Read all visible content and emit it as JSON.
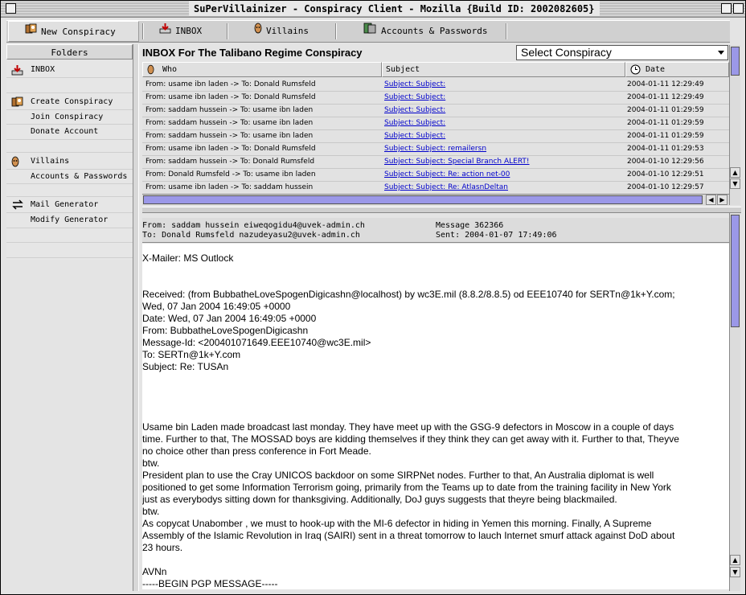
{
  "window": {
    "title": "SuPerVillainizer - Conspiracy Client - Mozilla {Build ID: 2002082605}"
  },
  "toolbar": {
    "new_conspiracy": "New Conspiracy",
    "inbox": "INBOX",
    "villains": "Villains",
    "accounts": "Accounts & Passwords"
  },
  "sidebar": {
    "header": "Folders",
    "items": {
      "inbox": "INBOX",
      "create": "Create Conspiracy",
      "join": "Join Conspiracy",
      "donate": "Donate Account",
      "villains": "Villains",
      "accounts": "Accounts & Passwords",
      "mailgen": "Mail Generator",
      "modgen": "Modify Generator"
    }
  },
  "inbox": {
    "title": "INBOX For The Talibano Regime Conspiracy",
    "select_value": "Select Conspiracy",
    "columns": {
      "who": "Who",
      "subject": "Subject",
      "date": "Date"
    },
    "rows": [
      {
        "who": "From: usame ibn laden -> To: Donald Rumsfeld",
        "subject": "Subject: Subject:",
        "date": "2004-01-11 12:29:49"
      },
      {
        "who": "From: usame ibn laden -> To: Donald Rumsfeld",
        "subject": "Subject: Subject:",
        "date": "2004-01-11 12:29:49"
      },
      {
        "who": "From: saddam hussein -> To: usame ibn laden",
        "subject": "Subject: Subject:",
        "date": "2004-01-11 01:29:59"
      },
      {
        "who": "From: saddam hussein -> To: usame ibn laden",
        "subject": "Subject: Subject:",
        "date": "2004-01-11 01:29:59"
      },
      {
        "who": "From: saddam hussein -> To: usame ibn laden",
        "subject": "Subject: Subject:",
        "date": "2004-01-11 01:29:59"
      },
      {
        "who": "From: usame ibn laden -> To: Donald Rumsfeld",
        "subject": "Subject: Subject: remailersn",
        "date": "2004-01-11 01:29:53"
      },
      {
        "who": "From: saddam hussein -> To: Donald Rumsfeld",
        "subject": "Subject: Subject: Special Branch ALERT!",
        "date": "2004-01-10 12:29:56"
      },
      {
        "who": "From: Donald Rumsfeld -> To: usame ibn laden",
        "subject": "Subject: Subject: Re: action net-00",
        "date": "2004-01-10 12:29:51"
      },
      {
        "who": "From: usame ibn laden -> To: saddam hussein",
        "subject": "Subject: Subject: Re: AtlasnDeltan",
        "date": "2004-01-10 12:29:57"
      }
    ]
  },
  "message": {
    "from": "From: saddam hussein eiweqogidu4@uvek-admin.ch",
    "to": "To: Donald Rumsfeld nazudeyasu2@uvek-admin.ch",
    "number": "Message 362366",
    "sent": "Sent: 2004-01-07 17:49:06",
    "body_lines": [
      "X-Mailer: MS Outlock",
      "",
      "",
      "Received: (from BubbatheLoveSpogenDigicashn@localhost) by wc3E.mil (8.8.2/8.8.5) od EEE10740 for SERTn@1k+Y.com;",
      "Wed, 07 Jan 2004 16:49:05 +0000",
      "Date: Wed, 07 Jan 2004 16:49:05 +0000",
      "From: BubbatheLoveSpogenDigicashn",
      "Message-Id: <200401071649.EEE10740@wc3E.mil>",
      "To: SERTn@1k+Y.com",
      "Subject: Re: TUSAn",
      "",
      "",
      "",
      "",
      "Usame bin Laden made broadcast last monday. They have meet up with the GSG-9 defectors in Moscow in a couple of days",
      "time. Further to that, The MOSSAD boys are kidding themselves if they think they can get away with it. Further to that, Theyve",
      "no choice other than press conference in Fort Meade.",
      "btw.",
      "President plan to use the Cray UNICOS backdoor on some SIRPNet nodes. Further to that, An Australia diplomat is well",
      "positioned to get some Information Terrorism going, primarily from the Teams up to date from the training facility in New York",
      "just as everybodys sitting down for thanksgiving. Additionally, DoJ guys suggests that theyre being blackmailed.",
      "btw.",
      "As copycat Unabomber , we must to hook-up with the MI-6 defector in hiding in Yemen this morning. Finally, A Supreme",
      "Assembly of the Islamic Revolution in Iraq (SAIRI) sent in a threat tomorrow to lauch Internet smurf attack against DoD about",
      "23 hours.",
      "",
      "AVNn",
      "-----BEGIN PGP MESSAGE-----"
    ]
  },
  "colors": {
    "link": "#0000cc",
    "scroll_thumb": "#9b98e8"
  }
}
